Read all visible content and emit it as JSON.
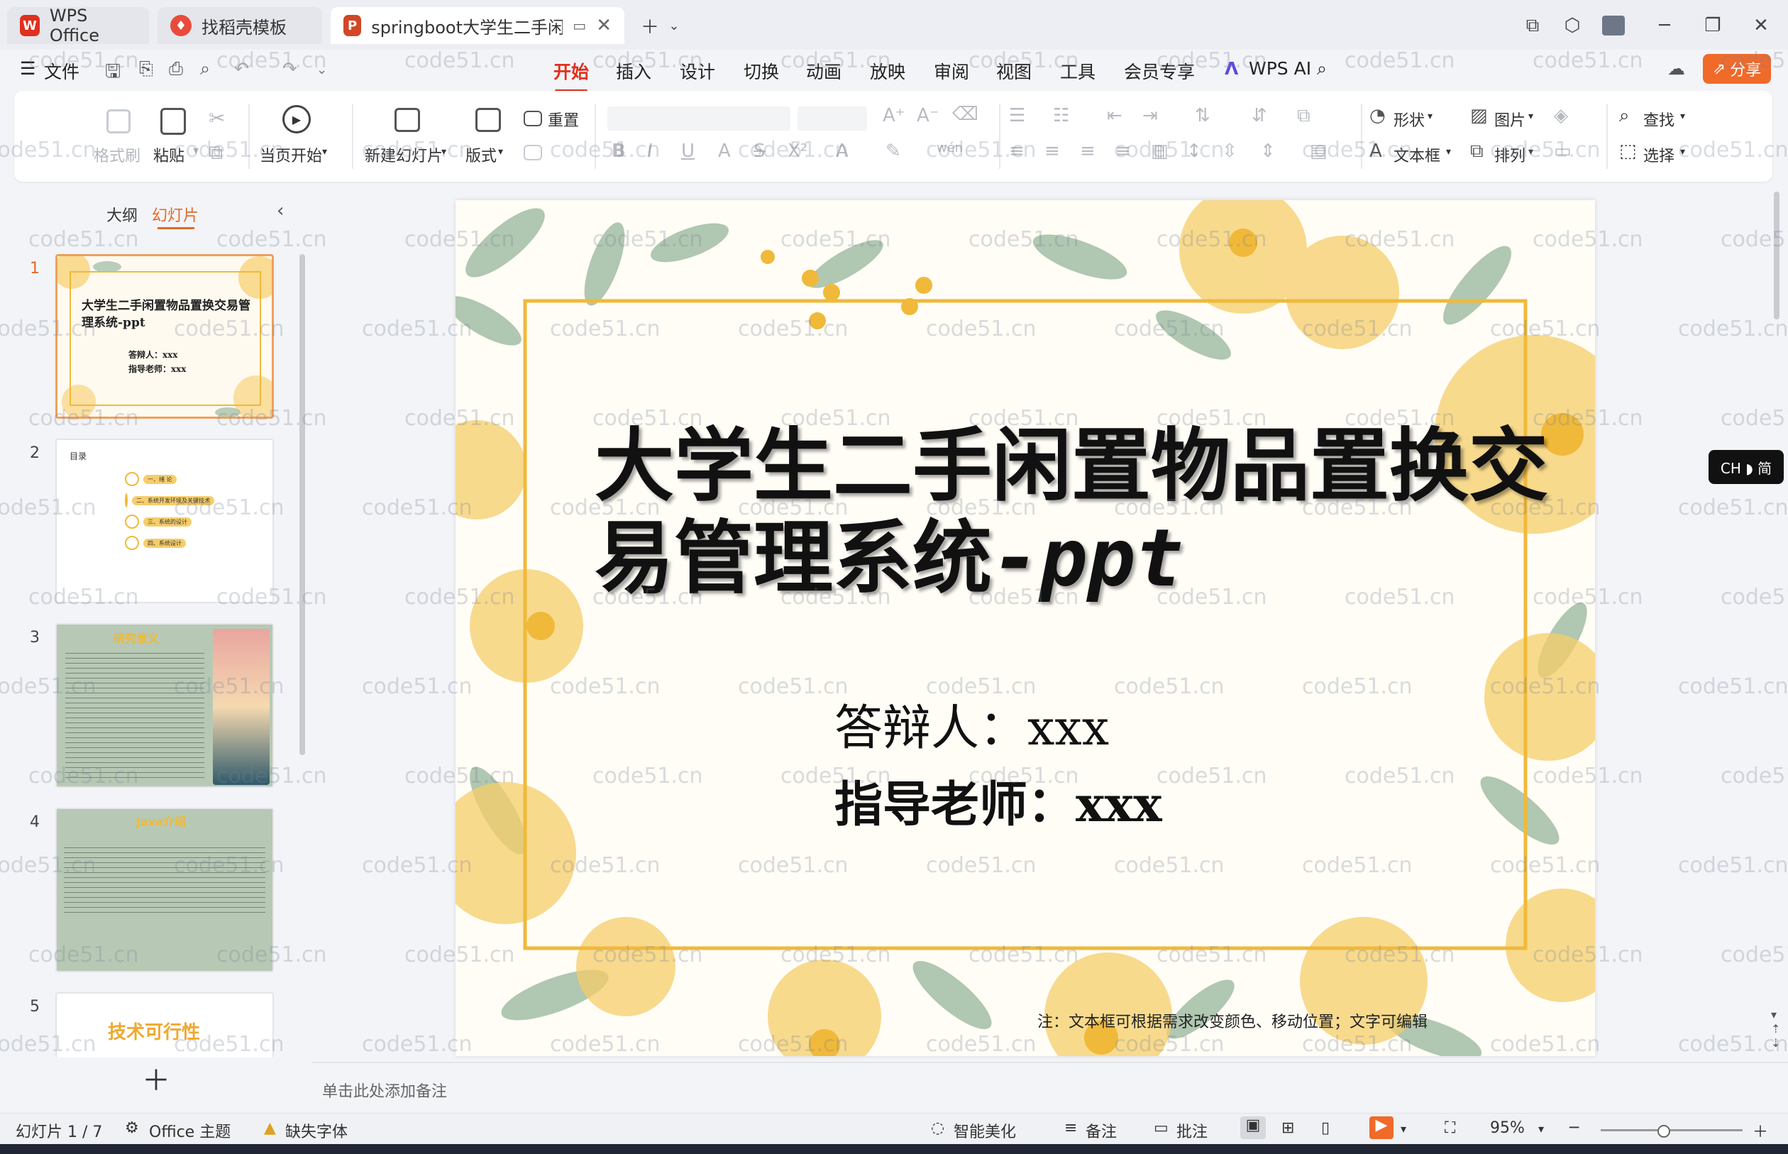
{
  "tabs": [
    {
      "label": "WPS Office",
      "color": "#e0301e"
    },
    {
      "label": "找稻壳模板",
      "color": "#e84b3c"
    },
    {
      "label": "springboot大学生二手闲置物",
      "color": "#d24726"
    }
  ],
  "menu": {
    "file": "文件",
    "items": [
      "开始",
      "插入",
      "设计",
      "切换",
      "动画",
      "放映",
      "审阅",
      "视图",
      "工具",
      "会员专享"
    ],
    "active": "开始",
    "wps_ai": "WPS AI",
    "share": "分享"
  },
  "ribbon": {
    "format_painter": "格式刷",
    "paste": "粘贴",
    "start_from_current": "当页开始",
    "new_slide": "新建幻灯片",
    "layout": "版式",
    "reset": "重置",
    "shape": "形状",
    "picture": "图片",
    "textbox": "文本框",
    "arrange": "排列",
    "find": "查找",
    "select": "选择"
  },
  "panel": {
    "tab_outline": "大纲",
    "tab_slides": "幻灯片",
    "slide_numbers": [
      "1",
      "2",
      "3",
      "4",
      "5"
    ],
    "thumb1_title": "大学生二手闲置物品置换交易管理系统-ppt",
    "thumb1_line1": "答辩人：xxx",
    "thumb1_line2": "指导老师：xxx",
    "thumb2_title": "目录",
    "thumb2_items": [
      "一、绪 论",
      "二、系统开发环境及关键技术",
      "三、系统的设计",
      "四、系统设计"
    ],
    "thumb3_title": "研究意义",
    "thumb4_title": "Java介绍",
    "thumb5_title": "技术可行性"
  },
  "slide": {
    "title_line1": "大学生二手闲置物品置换交",
    "title_line2_cn": "易管理系统",
    "title_line2_en": "-ppt",
    "presenter": "答辩人：xxx",
    "advisor": "指导老师：xxx",
    "note": "注：文本框可根据需求改变颜色、移动位置；文字可编辑",
    "frame_color": "#f0b93a"
  },
  "notes_placeholder": "单击此处添加备注",
  "status": {
    "slide_count": "幻灯片 1 / 7",
    "theme": "Office 主题",
    "missing_font": "缺失字体",
    "beautify": "智能美化",
    "notes": "备注",
    "comments": "批注",
    "zoom": "95%"
  },
  "ime": "CH ◗ 简",
  "watermark": "code51.cn"
}
